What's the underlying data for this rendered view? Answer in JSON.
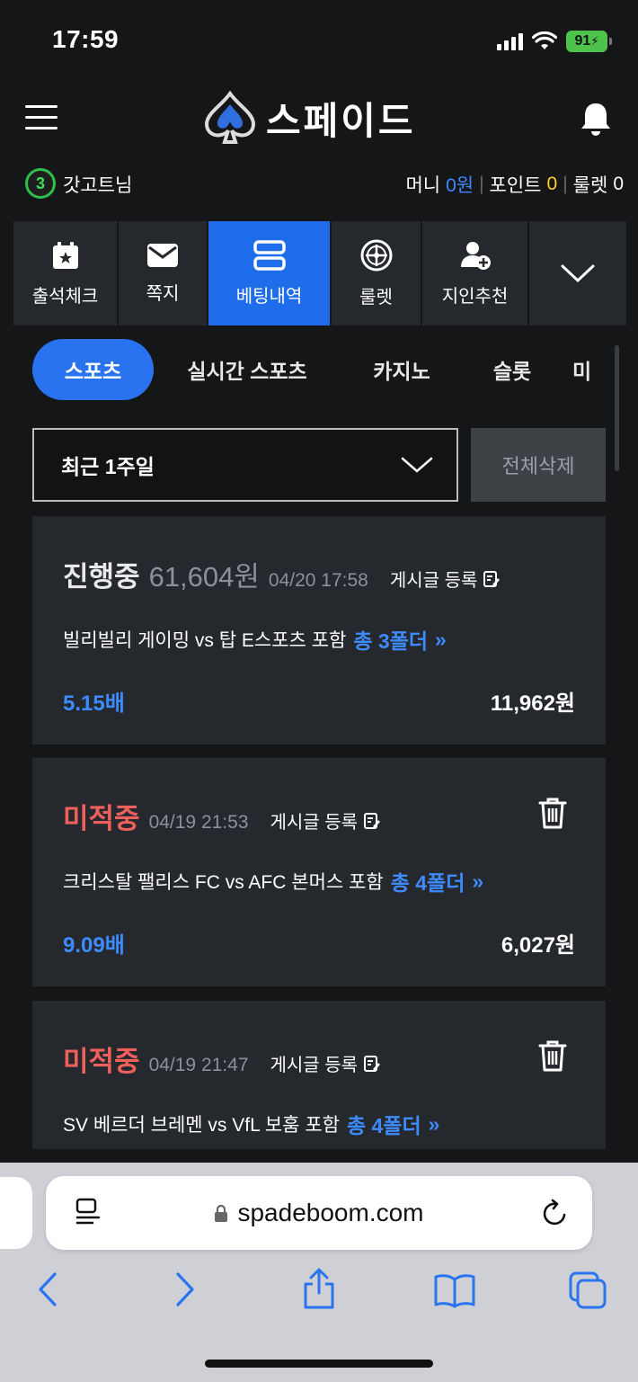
{
  "status": {
    "time": "17:59",
    "battery": "91"
  },
  "header": {
    "logo_text": "스페이드"
  },
  "user": {
    "level": "3",
    "name": "갓고트님",
    "money_label": "머니",
    "money_value": "0원",
    "point_label": "포인트",
    "point_value": "0",
    "roulette_label": "룰렛",
    "roulette_value": "0"
  },
  "quick_menu": [
    {
      "label": "출석체크",
      "icon": "calendar-star-icon"
    },
    {
      "label": "쪽지",
      "icon": "envelope-icon"
    },
    {
      "label": "베팅내역",
      "icon": "bet-list-icon",
      "active": true
    },
    {
      "label": "룰렛",
      "icon": "roulette-icon"
    },
    {
      "label": "지인추천",
      "icon": "add-user-icon"
    },
    {
      "label": "",
      "icon": "chevron-down-icon"
    }
  ],
  "tabs": [
    "스포츠",
    "실시간 스포츠",
    "카지노",
    "슬롯",
    "미"
  ],
  "filter": {
    "period": "최근 1주일",
    "delete_all": "전체삭제"
  },
  "bets": [
    {
      "status": "진행중",
      "amount": "61,604원",
      "datetime": "04/20 17:58",
      "post_label": "게시글 등록",
      "match": "빌리빌리 게이밍 vs 탑 E스포츠 포함",
      "folder": "총 3폴더",
      "odds": "5.15배",
      "win_amount": "11,962원"
    },
    {
      "status": "미적중",
      "datetime": "04/19 21:53",
      "post_label": "게시글 등록",
      "match": "크리스탈 팰리스 FC vs AFC 본머스 포함",
      "folder": "총 4폴더",
      "odds": "9.09배",
      "win_amount": "6,027원"
    },
    {
      "status": "미적중",
      "datetime": "04/19 21:47",
      "post_label": "게시글 등록",
      "match": "SV 베르더 브레멘 vs VfL 보훔 포함",
      "folder": "총 4폴더"
    }
  ],
  "browser": {
    "url": "spadeboom.com"
  },
  "colors": {
    "accent": "#2a73f0",
    "miss": "#ef5f5b",
    "money": "#3d8bff",
    "point": "#ffd21f",
    "card": "#25282c"
  }
}
